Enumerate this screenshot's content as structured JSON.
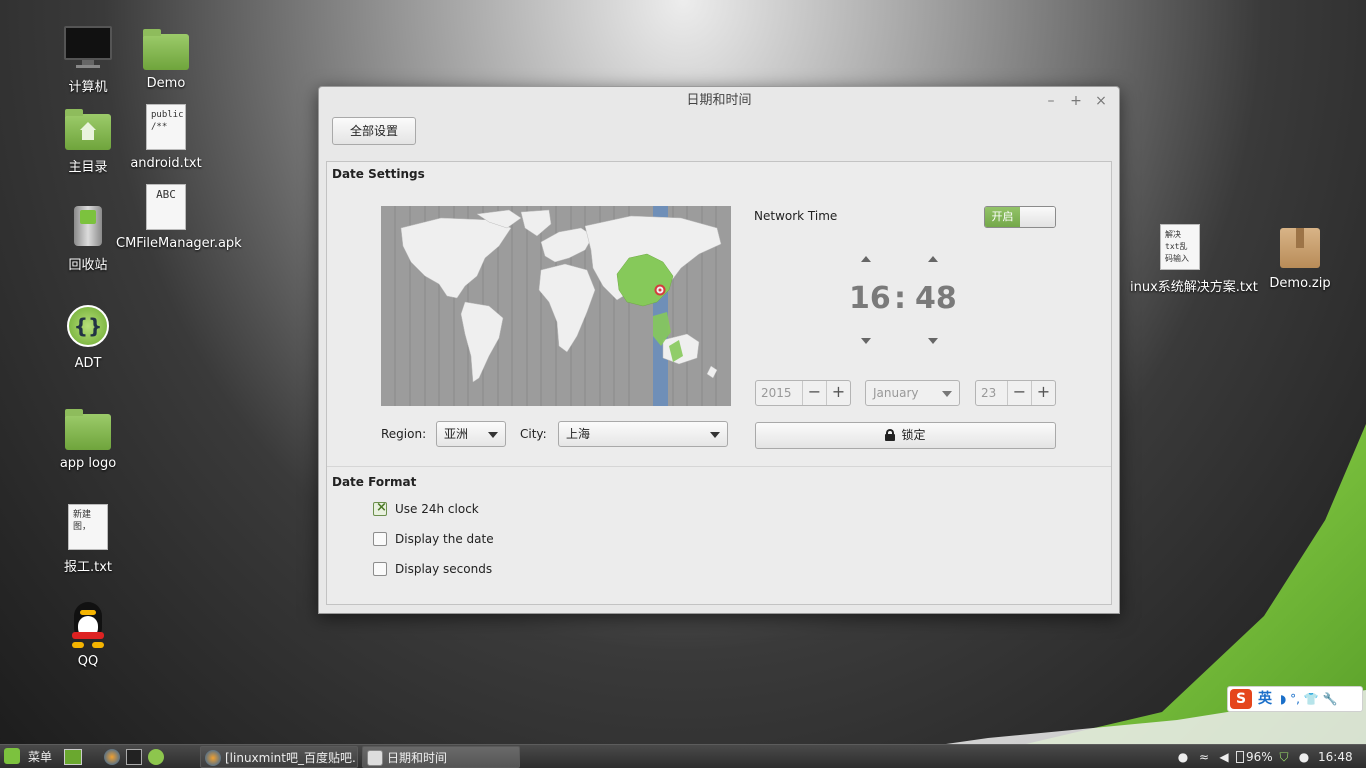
{
  "desktop": {
    "icons": [
      {
        "label": "计算机",
        "icon": "monitor-icon"
      },
      {
        "label": "Demo",
        "icon": "folder-icon"
      },
      {
        "label": "主目录",
        "icon": "home-folder-icon"
      },
      {
        "label": "android.txt",
        "icon": "text-file-icon",
        "preview": "public\n/**"
      },
      {
        "label": "回收站",
        "icon": "trash-icon"
      },
      {
        "label": "CMFileManager.apk",
        "icon": "apk-file-icon",
        "preview": "ABC"
      },
      {
        "label": "ADT",
        "icon": "adt-icon"
      },
      {
        "label": "app logo",
        "icon": "folder-icon"
      },
      {
        "label": "报工.txt",
        "icon": "text-file-icon",
        "preview": "新建图，"
      },
      {
        "label": "QQ",
        "icon": "qq-penguin-icon"
      },
      {
        "label": "inux系统解决方案.txt",
        "icon": "text-file-icon",
        "preview": "解决txt乱码输入"
      },
      {
        "label": "Demo.zip",
        "icon": "archive-icon"
      }
    ]
  },
  "window": {
    "title": "日期和时间",
    "controls": {
      "minimize": "–",
      "maximize": "+",
      "close": "×"
    },
    "all_settings_label": "全部设置",
    "date_settings": {
      "section_title": "Date Settings",
      "region_label": "Region:",
      "region_value": "亚洲",
      "city_label": "City:",
      "city_value": "上海",
      "network_time_label": "Network Time",
      "network_time_state": "开启",
      "hour": "16",
      "separator": ":",
      "minute": "48",
      "year": "2015",
      "month": "January",
      "day": "23",
      "minus": "−",
      "plus": "+",
      "lock_label": "锁定"
    },
    "date_format": {
      "section_title": "Date Format",
      "options": [
        {
          "label": "Use 24h clock",
          "checked": true
        },
        {
          "label": "Display the date",
          "checked": false
        },
        {
          "label": "Display seconds",
          "checked": false
        }
      ]
    }
  },
  "ime_bar": {
    "logo": "S",
    "mode": "英",
    "symbols": "◗ °, 👕 🔧"
  },
  "taskbar": {
    "menu_label": "菜单",
    "tasks": [
      {
        "label": "[linuxmint吧_百度贴吧...",
        "active": false
      },
      {
        "label": "日期和时间",
        "active": true
      }
    ],
    "battery": "96%",
    "clock": "16:48"
  },
  "colors": {
    "accent_green": "#7cc23e",
    "toggle_on": "#80b356",
    "highlight_country": "#86c95a",
    "timezone_band": "#6f8fb8"
  }
}
